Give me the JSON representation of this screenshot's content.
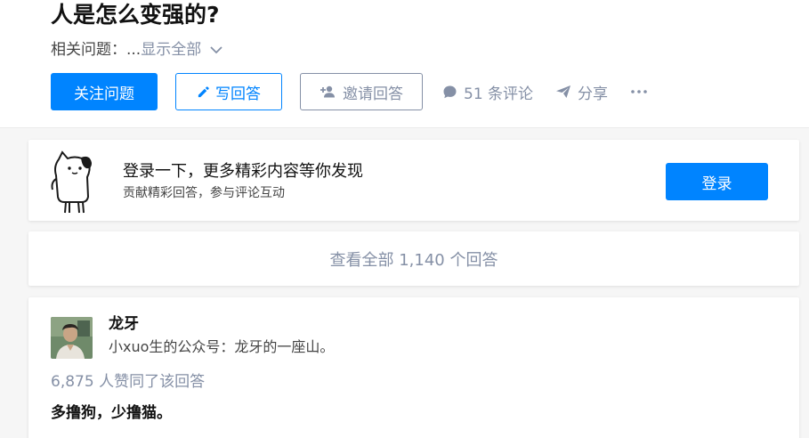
{
  "question": {
    "title": "人是怎么变强的?",
    "related_label": "相关问题：...",
    "show_all": "显示全部"
  },
  "actions": {
    "follow": "关注问题",
    "write": "写回答",
    "invite": "邀请回答",
    "comments": "51 条评论",
    "share": "分享",
    "more": "···"
  },
  "login_banner": {
    "title": "登录一下，更多精彩内容等你发现",
    "subtitle": "贡献精彩回答，参与评论互动",
    "button": "登录"
  },
  "view_all": "查看全部 1,140 个回答",
  "answer": {
    "author": "龙牙",
    "bio": "小xuo生的公众号：龙牙的一座山。",
    "votes": "6,875 人赞同了该回答",
    "text": "多撸狗，少撸猫。"
  },
  "colors": {
    "brand_blue": "#0084ff",
    "muted_gray": "#8590a6",
    "page_bg": "#f6f6f6"
  }
}
